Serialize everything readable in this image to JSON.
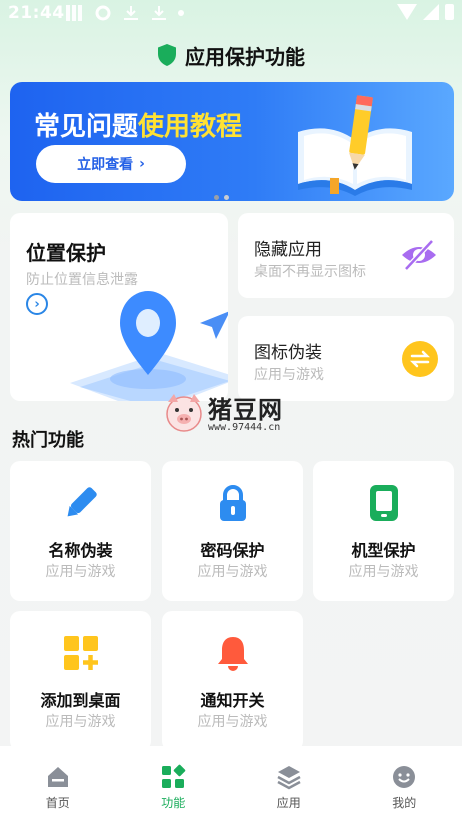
{
  "status_bar": {
    "time": "21:44"
  },
  "header": {
    "title": "应用保护功能"
  },
  "banner": {
    "headline_white": "常见问题",
    "headline_yellow": "使用教程",
    "cta_label": "立即查看",
    "cta_arrow": "›"
  },
  "location_card": {
    "title": "位置保护",
    "subtitle": "防止位置信息泄露",
    "go_arrow": "›"
  },
  "hide_app_card": {
    "title": "隐藏应用",
    "subtitle": "桌面不再显示图标"
  },
  "disguise_card": {
    "title": "图标伪装",
    "subtitle": "应用与游戏"
  },
  "watermark": {
    "name": "猪豆网",
    "url": "www.97444.cn"
  },
  "section": {
    "title": "热门功能"
  },
  "features": [
    {
      "title": "名称伪装",
      "subtitle": "应用与游戏",
      "icon": "pencil-icon"
    },
    {
      "title": "密码保护",
      "subtitle": "应用与游戏",
      "icon": "lock-icon"
    },
    {
      "title": "机型保护",
      "subtitle": "应用与游戏",
      "icon": "phone-icon"
    },
    {
      "title": "添加到桌面",
      "subtitle": "应用与游戏",
      "icon": "grid-plus-icon"
    },
    {
      "title": "通知开关",
      "subtitle": "应用与游戏",
      "icon": "bell-icon"
    }
  ],
  "tabs": [
    {
      "label": "首页",
      "icon": "home-icon"
    },
    {
      "label": "功能",
      "icon": "apps-icon",
      "active": true
    },
    {
      "label": "应用",
      "icon": "layers-icon"
    },
    {
      "label": "我的",
      "icon": "face-icon"
    }
  ],
  "colors": {
    "accent_green": "#1aad5b",
    "banner_blue": "#2f7cf6",
    "highlight_yellow": "#ffe233"
  }
}
